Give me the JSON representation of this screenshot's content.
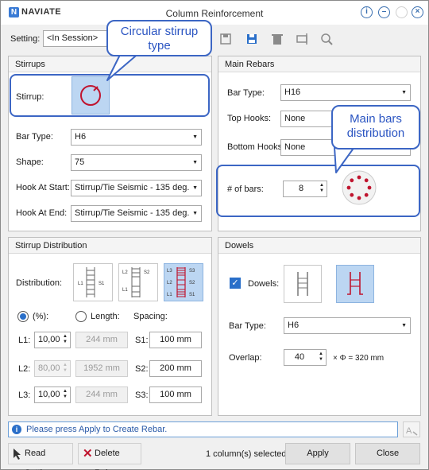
{
  "window": {
    "brand_letter": "N",
    "brand": "NAVIATE",
    "title": "Column Reinforcement",
    "help_icon": "info-circle-icon",
    "minimize_icon": "minus-circle-icon",
    "maximize_icon": "disabled-circle-icon",
    "close_icon": "close-circle-icon"
  },
  "setting": {
    "label": "Setting:",
    "value": "<In Session>"
  },
  "toolbar": {
    "icons": [
      "save-icon",
      "save-as-icon",
      "delete-icon",
      "rename-icon",
      "zoom-icon"
    ]
  },
  "callouts": {
    "stirrup": "Circular stirrup type",
    "main_bars": "Main bars distribution"
  },
  "stirrups": {
    "title": "Stirrups",
    "stirrup_label": "Stirrup:",
    "bar_type_label": "Bar Type:",
    "bar_type_value": "H6",
    "shape_label": "Shape:",
    "shape_value": "75",
    "hook_start_label": "Hook At Start:",
    "hook_start_value": "Stirrup/Tie Seismic - 135 deg.",
    "hook_end_label": "Hook At End:",
    "hook_end_value": "Stirrup/Tie Seismic - 135 deg."
  },
  "main_rebars": {
    "title": "Main Rebars",
    "bar_type_label": "Bar Type:",
    "bar_type_value": "H16",
    "top_hooks_label": "Top Hooks:",
    "top_hooks_value": "None",
    "bottom_hooks_label": "Bottom Hooks:",
    "bottom_hooks_value": "None",
    "num_bars_label": "# of bars:",
    "num_bars_value": "8"
  },
  "distribution": {
    "title": "Stirrup Distribution",
    "distribution_label": "Distribution:",
    "option_labels": [
      [
        "L1",
        "S1"
      ],
      [
        "L2",
        "S2",
        "L1"
      ],
      [
        "L3",
        "S3",
        "L2",
        "S2",
        "L1",
        "S1"
      ]
    ],
    "percent_label": "(%):",
    "length_label": "Length:",
    "spacing_label": "Spacing:",
    "rows": [
      {
        "l_label": "L1:",
        "pct": "10,00",
        "length": "244 mm",
        "s_label": "S1:",
        "spacing": "100 mm",
        "pct_enabled": true
      },
      {
        "l_label": "L2:",
        "pct": "80,00",
        "length": "1952 mm",
        "s_label": "S2:",
        "spacing": "200 mm",
        "pct_enabled": false
      },
      {
        "l_label": "L3:",
        "pct": "10,00",
        "length": "244 mm",
        "s_label": "S3:",
        "spacing": "100 mm",
        "pct_enabled": true
      }
    ]
  },
  "dowels": {
    "title": "Dowels",
    "dowels_label": "Dowels:",
    "dowels_checked": true,
    "bar_type_label": "Bar Type:",
    "bar_type_value": "H6",
    "overlap_label": "Overlap:",
    "overlap_value": "40",
    "overlap_formula": "× Φ = 320 mm"
  },
  "status": {
    "message": "Please press Apply to Create Rebar."
  },
  "footer": {
    "read_setting": "Read Setting",
    "delete_rebar": "Delete Rebar",
    "selection_info": "1 column(s) selected.",
    "apply": "Apply",
    "close": "Close"
  },
  "colors": {
    "accent": "#2a6fc9",
    "callout": "#3c66c4",
    "rebar": "#c0152f",
    "selected_bg": "#bcd6f2"
  }
}
